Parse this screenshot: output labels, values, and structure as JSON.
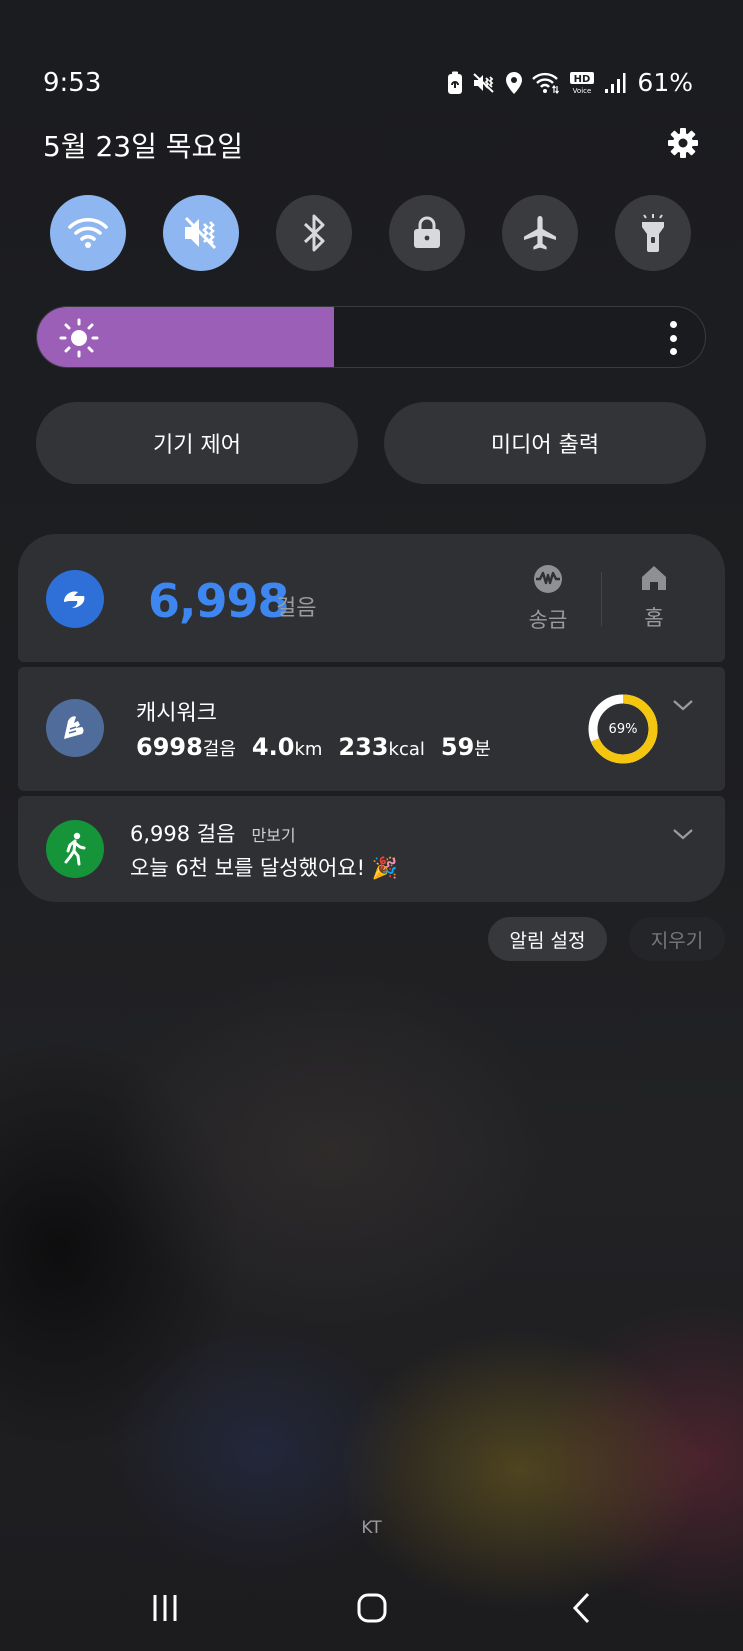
{
  "status_bar": {
    "time": "9:53",
    "battery": "61%",
    "hd_label": "HD",
    "voice_label": "Voice"
  },
  "header": {
    "date": "5월 23일 목요일"
  },
  "quick_settings": [
    {
      "icon": "wifi-icon",
      "state": "on"
    },
    {
      "icon": "sound-vibrate-icon",
      "state": "on"
    },
    {
      "icon": "bluetooth-icon",
      "state": "off"
    },
    {
      "icon": "lock-rotation-icon",
      "state": "off"
    },
    {
      "icon": "airplane-icon",
      "state": "off"
    },
    {
      "icon": "flashlight-icon",
      "state": "off"
    }
  ],
  "brightness": {
    "level": 0.445,
    "fill_color": "#9b5fb8"
  },
  "buttons": {
    "device_control": "기기 제어",
    "media_output": "미디어 출력"
  },
  "steps_card": {
    "count": "6,998",
    "unit": "걸음",
    "actions": [
      {
        "label": "송금",
        "icon": "remit-icon"
      },
      {
        "label": "홈",
        "icon": "home-icon"
      }
    ],
    "accent": "#3e86f0"
  },
  "cashwalk": {
    "title": "캐시워크",
    "steps_value": "6998",
    "steps_unit": "걸음",
    "distance_value": "4.0",
    "distance_unit": "km",
    "kcal_value": "233",
    "kcal_unit": "kcal",
    "minutes_value": "59",
    "minutes_unit": "분",
    "progress_label": "69%",
    "progress": 0.69,
    "ring_color": "#f5c60f"
  },
  "pedometer": {
    "title": "6,998 걸음",
    "app": "만보기",
    "message": "오늘 6천 보를 달성했어요! 🎉"
  },
  "notification_actions": {
    "settings": "알림 설정",
    "clear": "지우기"
  },
  "carrier": "KT"
}
